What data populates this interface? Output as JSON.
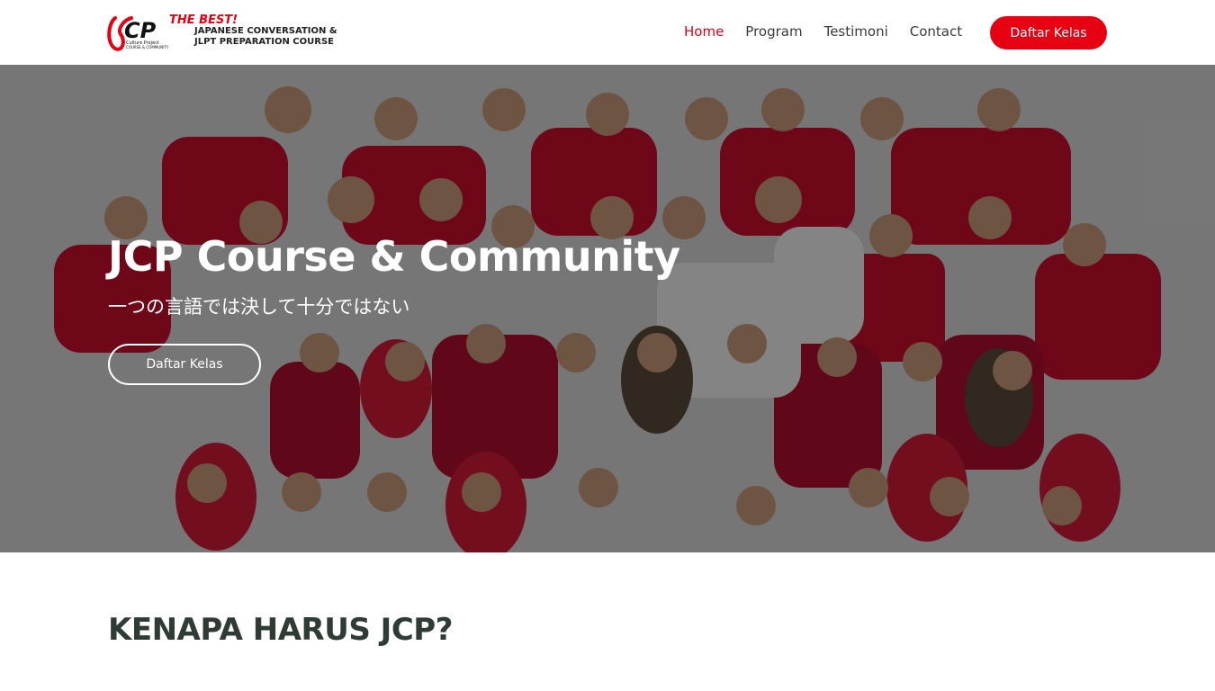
{
  "header": {
    "logo": {
      "mark": "JCP",
      "tagline_red": "THE BEST!",
      "line1": "JAPANESE CONVERSATION &",
      "line2": "JLPT PREPARATION COURSE",
      "small1": "Culture Project",
      "small2": "COURSE & COMMUNITY"
    },
    "nav": [
      "Home",
      "Program",
      "Testimoni",
      "Contact"
    ],
    "active_nav": "Home",
    "cta_label": "Daftar Kelas"
  },
  "hero": {
    "title": "JCP Course & Community",
    "subtitle": "一つの言語では決して十分ではない",
    "button_label": "Daftar Kelas",
    "image_description": "group-photo-students"
  },
  "section": {
    "title": "KENAPA HARUS JCP?"
  },
  "colors": {
    "accent": "#e60012",
    "nav_active": "#e3001b",
    "heading": "#2f3b35",
    "overlay": "rgba(0,0,0,0.45)"
  }
}
